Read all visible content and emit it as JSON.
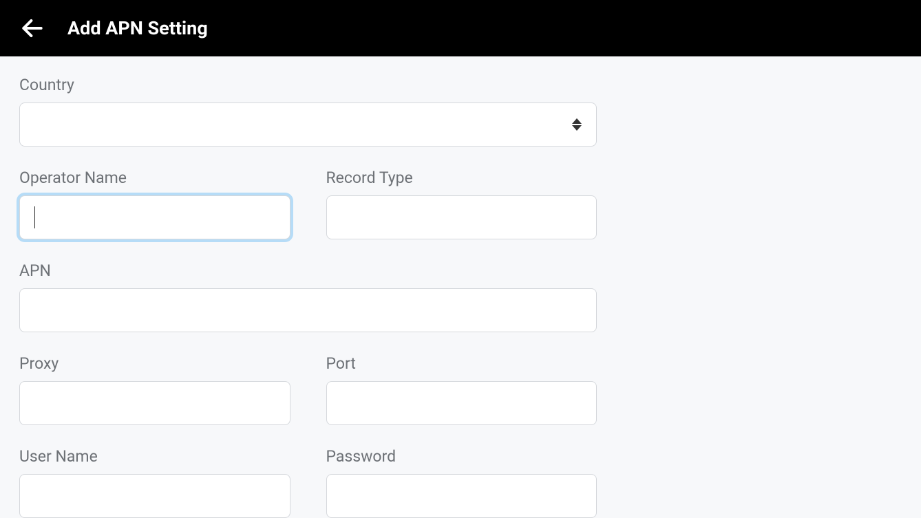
{
  "header": {
    "title": "Add APN Setting"
  },
  "form": {
    "country": {
      "label": "Country",
      "value": ""
    },
    "operator_name": {
      "label": "Operator Name",
      "value": ""
    },
    "record_type": {
      "label": "Record Type",
      "value": ""
    },
    "apn": {
      "label": "APN",
      "value": ""
    },
    "proxy": {
      "label": "Proxy",
      "value": ""
    },
    "port": {
      "label": "Port",
      "value": ""
    },
    "user_name": {
      "label": "User Name",
      "value": ""
    },
    "password": {
      "label": "Password",
      "value": ""
    }
  }
}
